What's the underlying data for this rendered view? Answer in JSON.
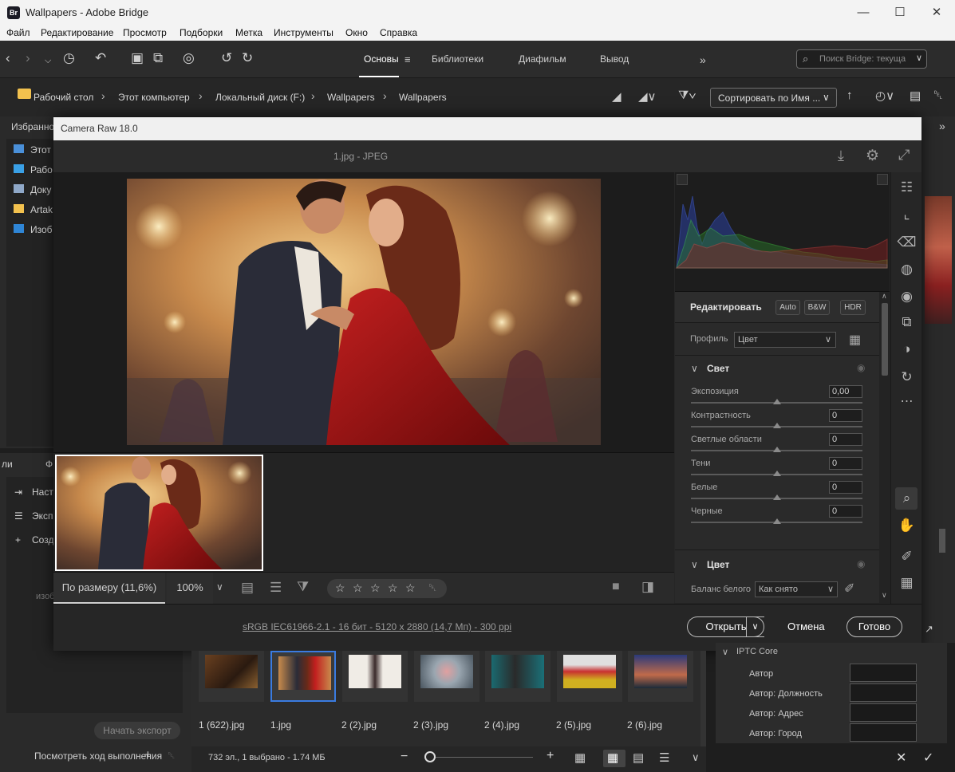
{
  "window": {
    "title": "Wallpapers - Adobe Bridge",
    "app_badge": "Br",
    "min": "—",
    "max": "☐",
    "close": "✕"
  },
  "menu": [
    "Файл",
    "Редактирование",
    "Просмотр",
    "Подборки",
    "Метка",
    "Инструменты",
    "Окно",
    "Справка"
  ],
  "workspace_tabs": {
    "t0": "Основы",
    "t1": "Библиотеки",
    "t2": "Диафильм",
    "t3": "Вывод"
  },
  "search": {
    "placeholder": "Поиск Bridge: текуща"
  },
  "breadcrumb": {
    "c0": "Рабочий стол",
    "c1": "Этот компьютер",
    "c2": "Локальный диск (F:)",
    "c3": "Wallpapers",
    "c4": "Wallpapers"
  },
  "sort": {
    "label": "Сортировать по Имя ..."
  },
  "favorites": {
    "tab": "Избранное",
    "items": {
      "i0": "Этот",
      "i1": "Рабо",
      "i2": "Доку",
      "i3": "Artak",
      "i4": "Изоб"
    }
  },
  "left_lower": {
    "tab_a": "ли",
    "tab_b": "Ф",
    "items": {
      "i0": "Настр",
      "i1": "Экспо",
      "i2": "Созда"
    },
    "faded": "изоб",
    "export_btn": "Начать экспорт",
    "progress": "Посмотреть ход выполнения"
  },
  "camera_raw": {
    "title": "Camera Raw 18.0",
    "file": "1.jpg  -  JPEG",
    "zoom_fit": "По размеру (11,6%)",
    "zoom_pct": "100%",
    "info": "sRGB IEC61966-2.1 - 16 бит - 5120 x 2880 (14,7 Мп) - 300 ppi",
    "open": "Открыть",
    "cancel": "Отмена",
    "done": "Готово",
    "edit": {
      "title": "Редактировать",
      "auto": "Auto",
      "bw": "B&W",
      "hdr": "HDR",
      "profile_label": "Профиль",
      "profile_value": "Цвет",
      "light": {
        "title": "Свет",
        "sliders": {
          "s0": {
            "label": "Экспозиция",
            "value": "0,00"
          },
          "s1": {
            "label": "Контрастность",
            "value": "0"
          },
          "s2": {
            "label": "Светлые области",
            "value": "0"
          },
          "s3": {
            "label": "Тени",
            "value": "0"
          },
          "s4": {
            "label": "Белые",
            "value": "0"
          },
          "s5": {
            "label": "Черные",
            "value": "0"
          }
        }
      },
      "color": {
        "title": "Цвет",
        "wb_label": "Баланс белого",
        "wb_value": "Как снято"
      }
    }
  },
  "content": {
    "files": {
      "f0": "1 (622).jpg",
      "f1": "1.jpg",
      "f2": "2 (2).jpg",
      "f3": "2 (3).jpg",
      "f4": "2 (4).jpg",
      "f5": "2 (5).jpg",
      "f6": "2 (6).jpg"
    },
    "status": "732 эл., 1 выбрано - 1.74 МБ"
  },
  "metadata": {
    "section": "IPTC Core",
    "fields": {
      "m0": "Автор",
      "m1": "Автор: Должность",
      "m2": "Автор: Адрес",
      "m3": "Автор: Город"
    }
  },
  "colors": {
    "accent_blue": "#4a7fd4",
    "folder": "#f2c14e",
    "dialog_bg": "#262626"
  }
}
